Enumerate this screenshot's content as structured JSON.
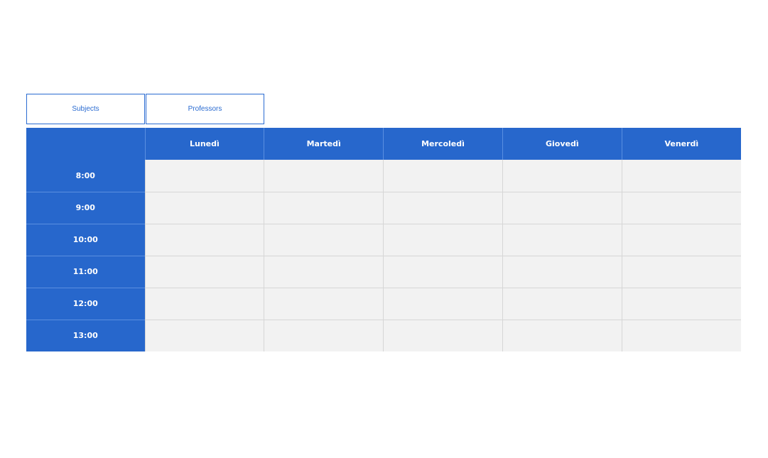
{
  "tabs": [
    {
      "label": "Subjects"
    },
    {
      "label": "Professors"
    }
  ],
  "timetable": {
    "corner": "",
    "days": [
      "Lunedì",
      "Martedì",
      "Mercoledì",
      "Giovedì",
      "Venerdì"
    ],
    "times": [
      "8:00",
      "9:00",
      "10:00",
      "11:00",
      "12:00",
      "13:00"
    ]
  },
  "colors": {
    "accent": "#2767cc",
    "cell_bg": "#f2f2f2",
    "tab_border": "#2a6bd1"
  }
}
